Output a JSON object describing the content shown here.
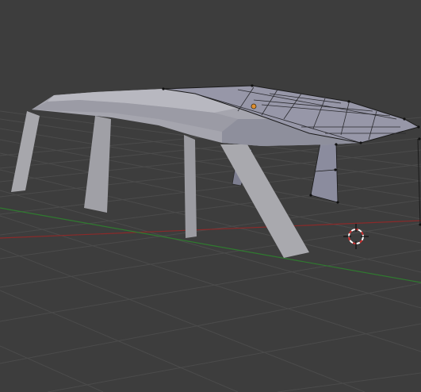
{
  "viewport": {
    "background": "#3d3d3d",
    "grid_color": "#4a4a4a",
    "x_axis_color": "#8a2a2a",
    "y_axis_color": "#2f7a2f",
    "mesh_base_color": "#9a9aa6",
    "mesh_light_color": "#b9b9c0",
    "mesh_dark_color": "#7d7e90",
    "selected_face_color": "#9797a8",
    "edge_color": "#1a1a1a",
    "origin_color": "#e09030",
    "cursor_color": "#d03030",
    "icons": [
      "3d-cursor-icon",
      "object-origin-icon"
    ]
  }
}
